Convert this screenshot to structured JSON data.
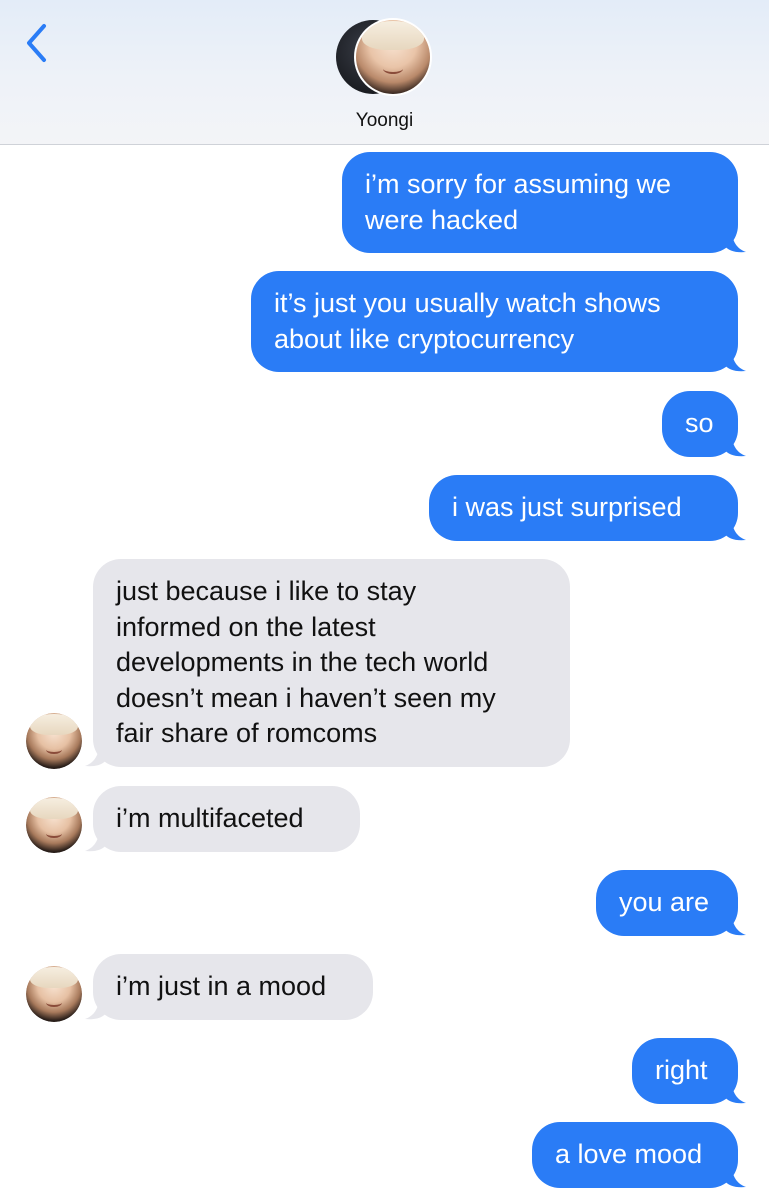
{
  "header": {
    "contact_name": "Yoongi",
    "back_icon": "chevron-left-icon",
    "accent_color": "#2a7cf6"
  },
  "colors": {
    "outgoing_bubble": "#2a7cf6",
    "incoming_bubble": "#e6e6eb",
    "outgoing_text": "#ffffff",
    "incoming_text": "#111111"
  },
  "messages": [
    {
      "direction": "out",
      "lines": [
        "i’m sorry for assuming we",
        "were hacked"
      ]
    },
    {
      "direction": "out",
      "lines": [
        "it’s just you usually watch shows",
        "about like cryptocurrency"
      ]
    },
    {
      "direction": "out",
      "lines": [
        "so"
      ]
    },
    {
      "direction": "out",
      "lines": [
        "i was just surprised"
      ]
    },
    {
      "direction": "in",
      "lines": [
        "just because i like to stay",
        "informed on the latest",
        "developments in the tech world",
        "doesn’t mean i haven’t seen my",
        "fair share of romcoms"
      ]
    },
    {
      "direction": "in",
      "lines": [
        "i’m multifaceted"
      ]
    },
    {
      "direction": "out",
      "lines": [
        "you are"
      ]
    },
    {
      "direction": "in",
      "lines": [
        "i’m just in a mood"
      ]
    },
    {
      "direction": "out",
      "lines": [
        "right"
      ]
    },
    {
      "direction": "out",
      "lines": [
        "a love mood"
      ]
    }
  ]
}
